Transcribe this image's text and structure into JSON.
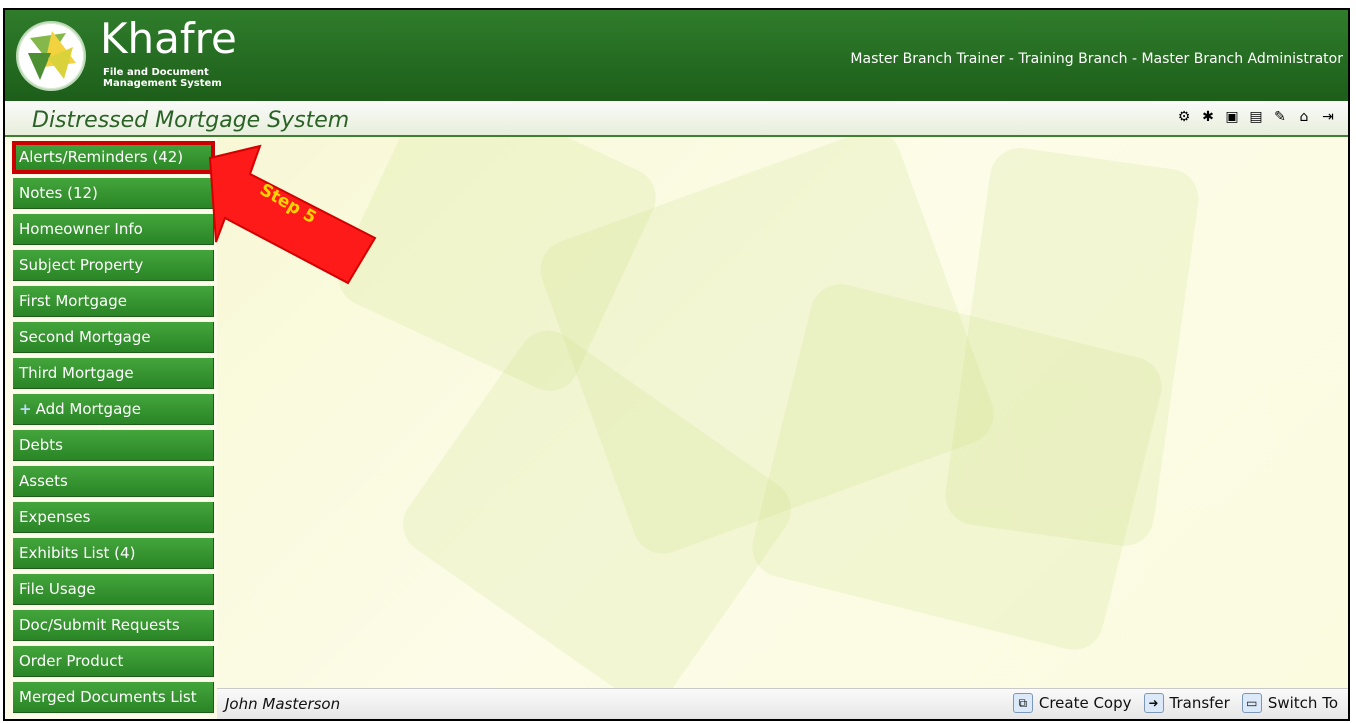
{
  "header": {
    "brand_name": "Khafre",
    "brand_sub_line1": "File and Document",
    "brand_sub_line2": "Management System",
    "user_role": "Master Branch Trainer - Training Branch - Master Branch Administrator"
  },
  "title_bar": {
    "system_title": "Distressed Mortgage System"
  },
  "sidebar": {
    "items": [
      {
        "label": "Alerts/Reminders (42)"
      },
      {
        "label": "Notes (12)"
      },
      {
        "label": "Homeowner Info"
      },
      {
        "label": "Subject Property"
      },
      {
        "label": "First Mortgage"
      },
      {
        "label": "Second Mortgage"
      },
      {
        "label": "Third Mortgage"
      },
      {
        "label": "Add Mortgage"
      },
      {
        "label": "Debts"
      },
      {
        "label": "Assets"
      },
      {
        "label": "Expenses"
      },
      {
        "label": "Exhibits List (4)"
      },
      {
        "label": "File Usage"
      },
      {
        "label": "Doc/Submit Requests"
      },
      {
        "label": "Order Product"
      },
      {
        "label": "Merged Documents List"
      }
    ]
  },
  "callout": {
    "text": "Step 5"
  },
  "status_bar": {
    "user_name": "John Masterson",
    "create_copy": "Create Copy",
    "transfer": "Transfer",
    "switch_to": "Switch To"
  },
  "toolbar_icons": [
    "gears-icon",
    "settings-icon",
    "folder-icon",
    "document-icon",
    "edit-icon",
    "home-icon",
    "logout-icon"
  ]
}
